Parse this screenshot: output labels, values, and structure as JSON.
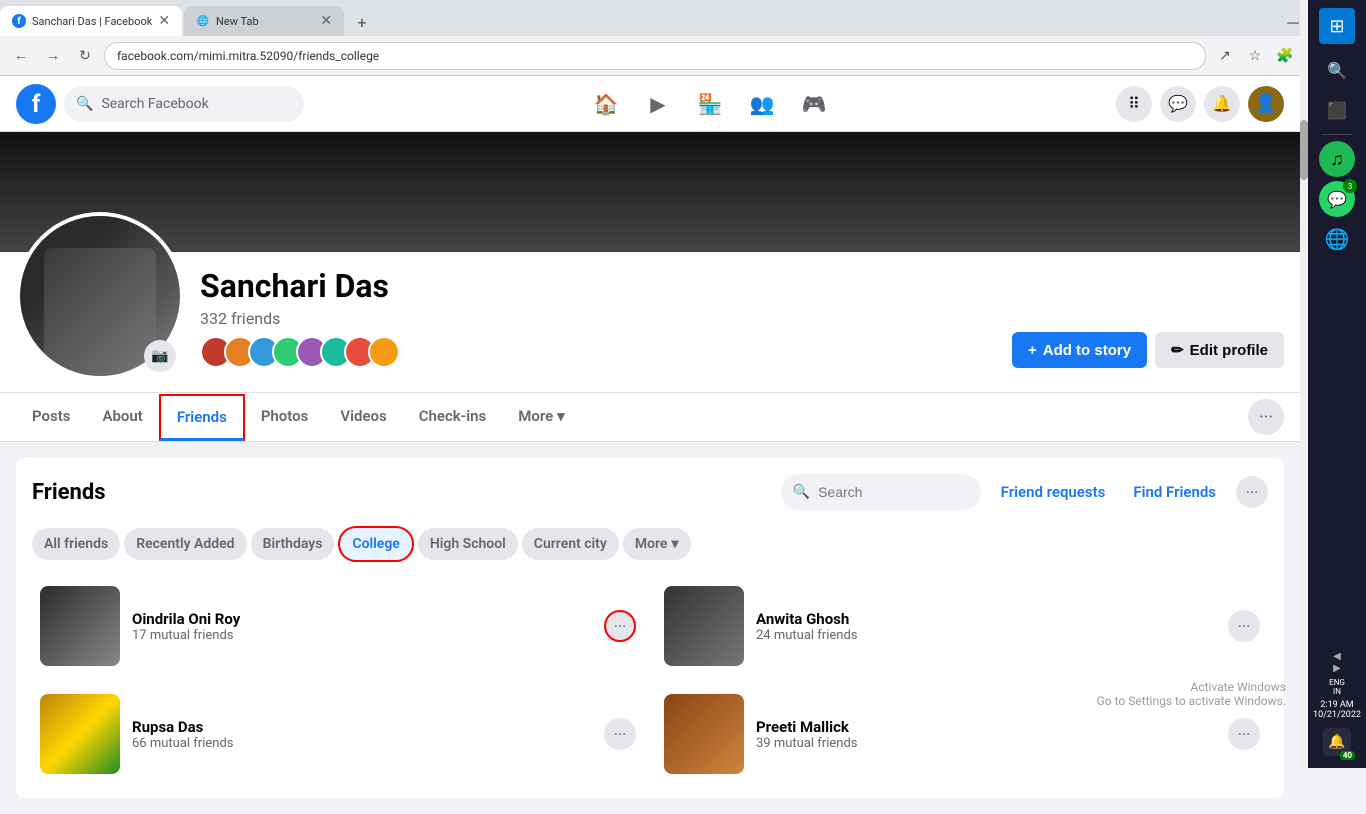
{
  "browser": {
    "tabs": [
      {
        "id": "tab-facebook",
        "title": "Sanchari Das | Facebook",
        "url": "facebook.com/mimi.mitra.52090/friends_college",
        "active": true,
        "favicon_color": "#1877f2",
        "favicon_letter": "f"
      },
      {
        "id": "tab-newtab",
        "title": "New Tab",
        "active": false,
        "favicon": "⬜"
      }
    ],
    "address": "facebook.com/mimi.mitra.52090/friends_college"
  },
  "header": {
    "search_placeholder": "Search Facebook",
    "nav_icons": [
      "🏠",
      "▶",
      "🏪",
      "👥",
      "⬛"
    ],
    "right_icons": [
      "⠿",
      "💬",
      "🔔"
    ]
  },
  "profile": {
    "name": "Sanchari Das",
    "friend_count": "332 friends",
    "tabs": [
      {
        "id": "posts",
        "label": "Posts",
        "active": false
      },
      {
        "id": "about",
        "label": "About",
        "active": false
      },
      {
        "id": "friends",
        "label": "Friends",
        "active": true,
        "highlighted": true
      },
      {
        "id": "photos",
        "label": "Photos",
        "active": false
      },
      {
        "id": "videos",
        "label": "Videos",
        "active": false
      },
      {
        "id": "checkins",
        "label": "Check-ins",
        "active": false
      },
      {
        "id": "more",
        "label": "More",
        "active": false,
        "dropdown": true
      }
    ],
    "actions": [
      {
        "id": "add-story",
        "label": "Add to story",
        "type": "primary"
      },
      {
        "id": "edit-profile",
        "label": "Edit profile",
        "type": "secondary"
      }
    ]
  },
  "friends": {
    "section_title": "Friends",
    "search_placeholder": "Search",
    "link_friend_requests": "Friend requests",
    "link_find_friends": "Find Friends",
    "filter_tabs": [
      {
        "id": "all",
        "label": "All friends",
        "active": false
      },
      {
        "id": "recently-added",
        "label": "Recently Added",
        "active": false
      },
      {
        "id": "birthdays",
        "label": "Birthdays",
        "active": false
      },
      {
        "id": "college",
        "label": "College",
        "active": true,
        "highlighted": true
      },
      {
        "id": "high-school",
        "label": "High School",
        "active": false
      },
      {
        "id": "current-city",
        "label": "Current city",
        "active": false
      },
      {
        "id": "more",
        "label": "More",
        "active": false,
        "dropdown": true
      }
    ],
    "friends_list": [
      {
        "id": "f1",
        "name": "Oindrila Oni Roy",
        "mutual": "17 mutual friends",
        "photo_class": "photo-1"
      },
      {
        "id": "f2",
        "name": "Anwita Ghosh",
        "mutual": "24 mutual friends",
        "photo_class": "photo-2"
      },
      {
        "id": "f3",
        "name": "Rupsa Das",
        "mutual": "66 mutual friends",
        "photo_class": "photo-3"
      },
      {
        "id": "f4",
        "name": "Preeti Mallick",
        "mutual": "39 mutual friends",
        "photo_class": "photo-4"
      }
    ]
  },
  "taskbar": {
    "time": "2:19 AM",
    "date": "10/21/2022",
    "notification_count": "40",
    "whatsapp_badge": "3"
  },
  "activate_windows": {
    "line1": "Activate Windows",
    "line2": "Go to Settings to activate Windows."
  }
}
